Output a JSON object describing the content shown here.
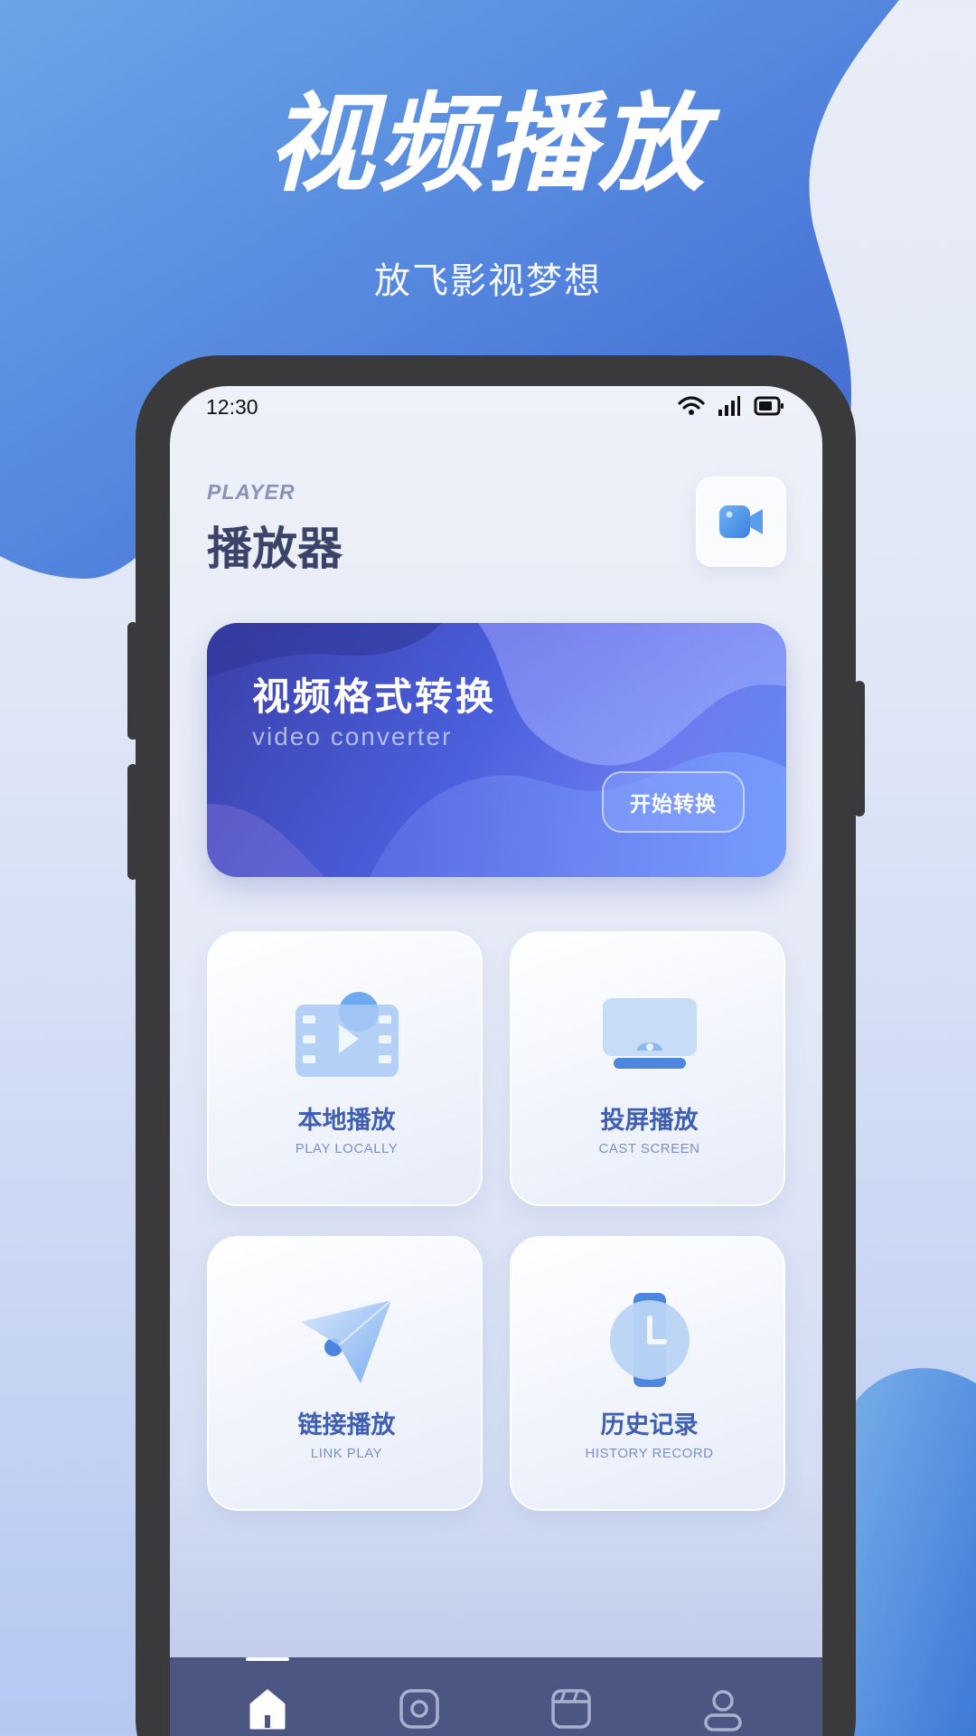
{
  "hero": {
    "title": "视频播放",
    "subtitle": "放飞影视梦想"
  },
  "status_bar": {
    "time": "12:30",
    "icons": [
      "wifi-icon",
      "signal-icon",
      "battery-icon"
    ]
  },
  "header": {
    "subtitle": "PLAYER",
    "title": "播放器",
    "action_icon": "video-camera-icon"
  },
  "banner": {
    "title": "视频格式转换",
    "subtitle": "video converter",
    "button_label": "开始转换"
  },
  "features": [
    {
      "title": "本地播放",
      "subtitle": "PLAY LOCALLY",
      "icon": "film-play-icon"
    },
    {
      "title": "投屏播放",
      "subtitle": "CAST SCREEN",
      "icon": "cast-screen-icon"
    },
    {
      "title": "链接播放",
      "subtitle": "LINK PLAY",
      "icon": "paper-plane-icon"
    },
    {
      "title": "历史记录",
      "subtitle": "HISTORY RECORD",
      "icon": "watch-clock-icon"
    }
  ],
  "bottom_nav": {
    "items": [
      "home-icon",
      "camera-icon",
      "clapperboard-icon",
      "user-icon"
    ],
    "active_index": 0
  },
  "colors": {
    "accent": "#3e5fb2",
    "hero_blue": "#4f7fdc",
    "nav_bg": "#4b5683",
    "title_dark": "#3b4468"
  }
}
